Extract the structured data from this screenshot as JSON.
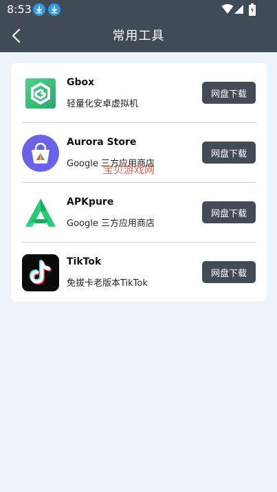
{
  "status_bar": {
    "time": "8:53"
  },
  "header": {
    "title": "常用工具"
  },
  "tools": [
    {
      "name": "Gbox",
      "desc": "轻量化安卓虚拟机",
      "button": "网盘下载",
      "icon": "gbox-icon"
    },
    {
      "name": "Aurora Store",
      "desc": "Google 三方应用商店",
      "button": "网盘下载",
      "icon": "aurora-store-icon"
    },
    {
      "name": "APKpure",
      "desc": "Google 三方应用商店",
      "button": "网盘下载",
      "icon": "apkpure-icon"
    },
    {
      "name": "TikTok",
      "desc": "免拔卡老版本TikTok",
      "button": "网盘下载",
      "icon": "tiktok-icon"
    }
  ],
  "watermark": "宝贝游戏网",
  "colors": {
    "header": "#414b55",
    "button": "#434c56",
    "background": "#eef2fb"
  }
}
